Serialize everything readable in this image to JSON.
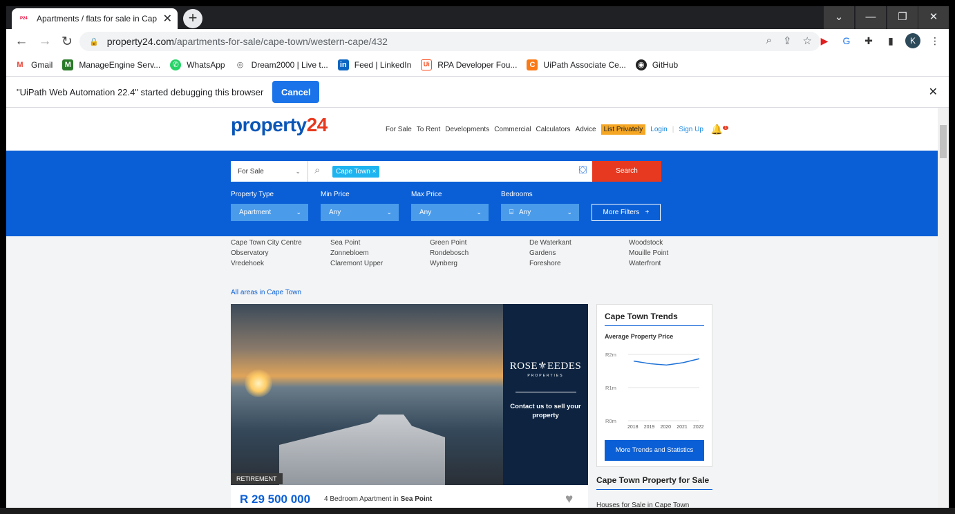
{
  "browser": {
    "tab_title": "Apartments / flats for sale in Cap",
    "tab_favicon": "P24",
    "url_domain": "property24.com",
    "url_path": "/apartments-for-sale/cape-town/western-cape/432",
    "profile_initial": "K"
  },
  "bookmarks": [
    {
      "label": "Gmail",
      "icon": "M",
      "color": "#ea4335"
    },
    {
      "label": "ManageEngine Serv...",
      "icon": "M",
      "color": "#2a7a2a"
    },
    {
      "label": "WhatsApp",
      "icon": "W",
      "color": "#25d366"
    },
    {
      "label": "Dream2000 | Live t...",
      "icon": "◎",
      "color": "#555555"
    },
    {
      "label": "Feed | LinkedIn",
      "icon": "in",
      "color": "#0a66c2"
    },
    {
      "label": "RPA Developer Fou...",
      "icon": "Ui",
      "color": "#fa4616"
    },
    {
      "label": "UiPath Associate Ce...",
      "icon": "C",
      "color": "#fa7a16"
    },
    {
      "label": "GitHub",
      "icon": "◉",
      "color": "#222222"
    }
  ],
  "debug_bar": {
    "message": "\"UiPath Web Automation 22.4\" started debugging this browser",
    "cancel_label": "Cancel"
  },
  "site": {
    "logo_main": "property",
    "logo_num": "24",
    "nav": [
      "For Sale",
      "To Rent",
      "Developments",
      "Commercial",
      "Calculators",
      "Advice"
    ],
    "list_privately": "List Privately",
    "login": "Login",
    "signup": "Sign Up",
    "notification_count": "1"
  },
  "search": {
    "mode": "For Sale",
    "location_chip": "Cape Town",
    "button": "Search",
    "filters": {
      "property_type_label": "Property Type",
      "property_type_value": "Apartment",
      "min_price_label": "Min Price",
      "min_price_value": "Any",
      "max_price_label": "Max Price",
      "max_price_value": "Any",
      "bedrooms_label": "Bedrooms",
      "bedrooms_value": "Any",
      "more_filters": "More Filters"
    }
  },
  "areas": [
    "Cape Town City Centre",
    "Sea Point",
    "Green Point",
    "De Waterkant",
    "Woodstock",
    "Observatory",
    "Zonnebloem",
    "Rondebosch",
    "Gardens",
    "Mouille Point",
    "Vredehoek",
    "Claremont Upper",
    "Wynberg",
    "Foreshore",
    "Waterfront"
  ],
  "all_areas_link": "All areas in Cape Town",
  "listing": {
    "tag": "RETIREMENT",
    "price": "R 29 500 000",
    "desc_prefix": "4 Bedroom Apartment in",
    "desc_location": "Sea Point",
    "ad_brand": "ROSE⚜EEDES",
    "ad_sub": "PROPERTIES",
    "ad_cta": "Contact us to sell your property"
  },
  "trends": {
    "title": "Cape Town Trends",
    "subtitle": "Average Property Price",
    "button": "More Trends and Statistics"
  },
  "chart_data": {
    "type": "line",
    "title": "Average Property Price",
    "categories": [
      "2018",
      "2019",
      "2020",
      "2021",
      "2022"
    ],
    "y_ticks": [
      "R2m",
      "R1m",
      "R0m"
    ],
    "ylim": [
      0,
      2
    ],
    "series": [
      {
        "values": [
          1.8,
          1.72,
          1.68,
          1.75,
          1.87
        ]
      }
    ],
    "color": "#1a6fd6"
  },
  "sidebar": {
    "for_sale_title": "Cape Town Property for Sale",
    "houses_link": "Houses for Sale in Cape Town"
  }
}
